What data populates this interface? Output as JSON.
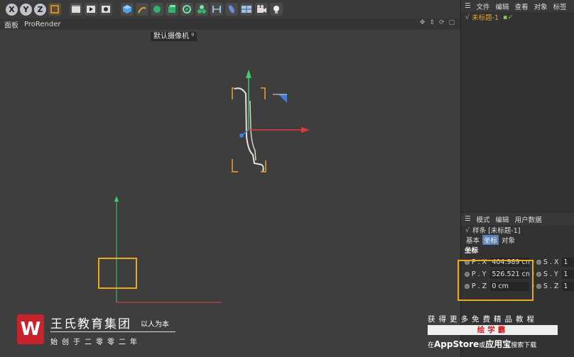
{
  "toolbar": {
    "axis_x": "X",
    "axis_y": "Y",
    "axis_z": "Z",
    "icons": [
      "coord-system-icon",
      "render-region-icon",
      "render-view-icon",
      "render-settings-icon",
      "cube-icon",
      "pen-icon",
      "subdivision-icon",
      "extrude-icon",
      "array-icon",
      "mograph-icon",
      "deformer-icon",
      "effector-icon",
      "floor-icon",
      "camera-icon",
      "light-icon"
    ]
  },
  "viewport_header": {
    "menu_panel": "面板",
    "menu_prorender": "ProRender",
    "camera_label": "默认摄像机"
  },
  "object_manager": {
    "menu": [
      "文件",
      "编辑",
      "查看",
      "对象",
      "标签"
    ],
    "object_name": "未标题-1"
  },
  "attributes": {
    "menu": [
      "模式",
      "编辑",
      "用户数据"
    ],
    "title": "样条 [未标题-1]",
    "tabs": [
      "基本",
      "坐标",
      "对象"
    ],
    "active_tab": "坐标",
    "section": "坐标",
    "rows": [
      {
        "p_label": "P . X",
        "p_value": "404.989 cn",
        "s_label": "S . X",
        "s_value": "1"
      },
      {
        "p_label": "P . Y",
        "p_value": "526.521 cn",
        "s_label": "S . Y",
        "s_value": "1"
      },
      {
        "p_label": "P . Z",
        "p_value": "0 cm",
        "s_label": "S . Z",
        "s_value": "1"
      }
    ]
  },
  "watermark": {
    "logo_letter": "W",
    "title": "王氏教育集团",
    "motto": "以人为本",
    "subtitle": "始创于二零零二年"
  },
  "promo": {
    "top": "获得更多免费精品教程",
    "middle": "绘学霸",
    "bottom_prefix": "在",
    "appstore": "AppStore",
    "bottom_or": "或",
    "app_center": "应用宝",
    "bottom_suffix": "搜索下载"
  },
  "colors": {
    "highlight": "#e8a820",
    "axis_x": "#e0393b",
    "axis_y": "#3ecf6b",
    "axis_z": "#3a7fe0",
    "spline": "#e0d8cc"
  }
}
